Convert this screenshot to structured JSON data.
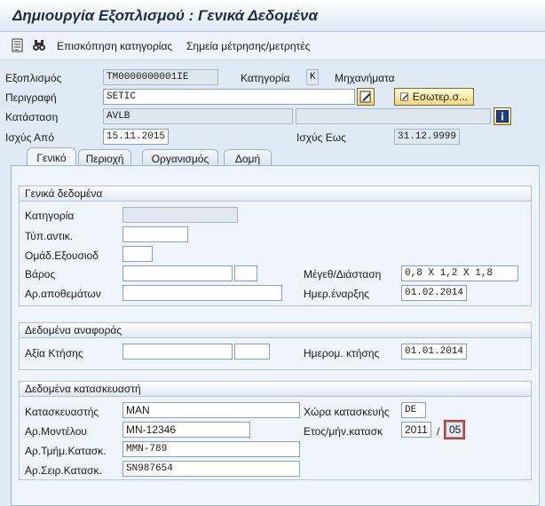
{
  "window": {
    "title": "Δημιουργία Εξοπλισμού : Γενικά Δεδομένα"
  },
  "toolbar": {
    "icons": [
      "document-list-icon",
      "binoculars-icon"
    ],
    "link1": "Επισκόπηση κατηγορίας",
    "link2": "Σημεία μέτρησης/μετρητές"
  },
  "header": {
    "equipment_label": "Εξοπλισμός",
    "equipment_value": "TM0000000001IE",
    "category_label": "Κατηγορία",
    "category_value": "K",
    "category_text": "Μηχανήματα",
    "description_label": "Περιγραφή",
    "description_value": "SETIC",
    "internal_button": "Εσωτερ.σ...",
    "status_label": "Κατάσταση",
    "status_value": "AVLB",
    "status_extra_value": "",
    "valid_from_label": "Ισχύς Από",
    "valid_from_value": "15.11.2015",
    "valid_to_label": "Ισχύς Εως",
    "valid_to_value": "31.12.9999"
  },
  "tabs": [
    {
      "label": "Γενικό"
    },
    {
      "label": "Περιοχή"
    },
    {
      "label": "Οργανισμός"
    },
    {
      "label": "Δομή"
    }
  ],
  "general": {
    "title": "Γενικά δεδομένα",
    "category_label": "Κατηγορία",
    "category_value": "",
    "object_type_label": "Τύπ.αντικ.",
    "object_type_value": "",
    "auth_group_label": "Ομάδ.Εξουσιοδ",
    "auth_group_value": "",
    "weight_label": "Βάρος",
    "weight_value": "",
    "weight_unit": "",
    "size_label": "Μέγεθ/Διάσταση",
    "size_value": "0,8 X 1,2 X 1,8",
    "inventory_label": "Αρ.αποθεμάτων",
    "inventory_value": "",
    "startup_label": "Ημερ.έναρξης",
    "startup_value": "01.02.2014"
  },
  "reference": {
    "title": "Δεδομένα αναφοράς",
    "acq_value_label": "Αξία Κτήσης",
    "acq_value_value": "",
    "acq_currency": "",
    "acq_date_label": "Ημερομ. κτήσης",
    "acq_date_value": "01.01.2014"
  },
  "manufacturer": {
    "title": "Δεδομένα κατασκευαστή",
    "manufacturer_label": "Κατασκευαστής",
    "manufacturer_value": "MAN",
    "country_label": "Χώρα κατασκευής",
    "country_value": "DE",
    "model_label": "Αρ.Μοντέλου",
    "model_value": "MN-12346",
    "year_month_label": "Ετος/μήν.κατασκ",
    "year_value": "2011",
    "separator": "/",
    "month_value": "05",
    "part_label": "Αρ.Τμήμ.Κατασκ.",
    "part_value": "MMN-789",
    "serial_label": "Αρ.Σειρ.Κατασκ.",
    "serial_value": "SN987654"
  }
}
